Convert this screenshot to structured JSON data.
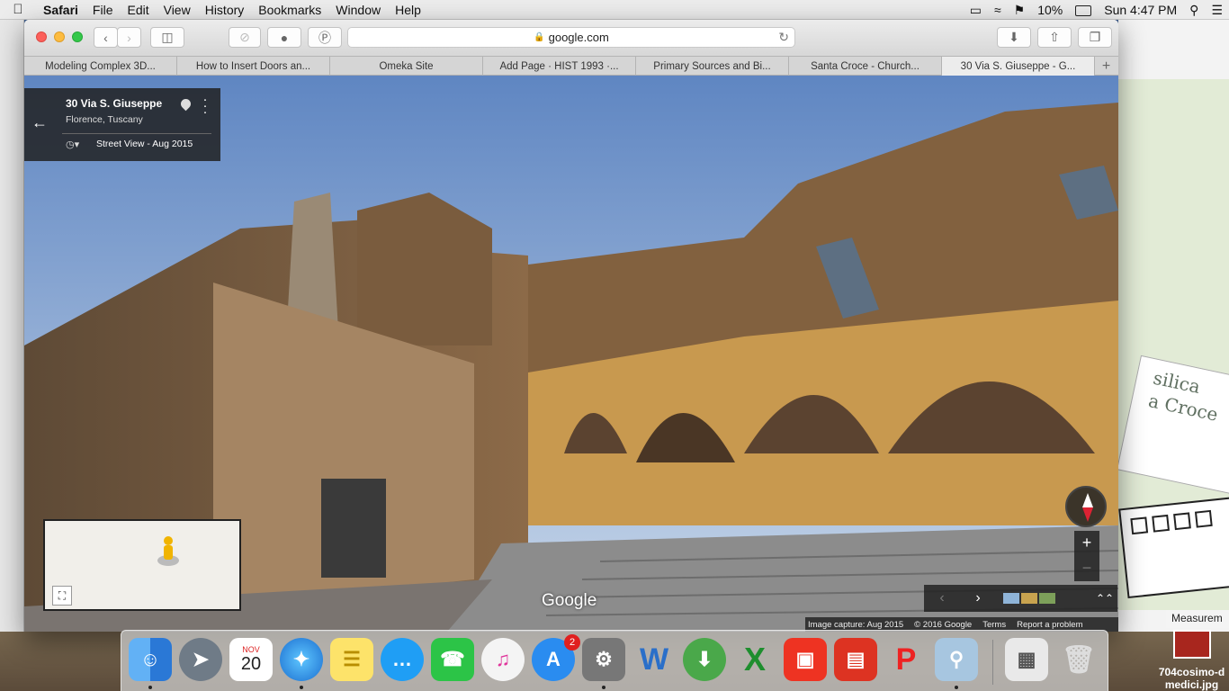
{
  "menubar": {
    "app": "Safari",
    "items": [
      "File",
      "Edit",
      "View",
      "History",
      "Bookmarks",
      "Window",
      "Help"
    ],
    "battery": "10%",
    "clock": "Sun 4:47 PM"
  },
  "browser": {
    "url": "google.com",
    "tabs": [
      "Modeling Complex 3D...",
      "How to Insert Doors an...",
      "Omeka Site",
      "Add Page · HIST 1993 ·...",
      "Primary Sources and Bi...",
      "Santa Croce - Church...",
      "30 Via S. Giuseppe - G..."
    ],
    "active_tab_index": 6,
    "new_tab": "+"
  },
  "streetview": {
    "address": "30 Via S. Giuseppe",
    "city": "Florence, Tuscany",
    "history_label": "Street View - Aug 2015",
    "logo": "Google",
    "zoom_in": "+",
    "zoom_out": "−",
    "footer": {
      "capture": "Image capture: Aug 2015",
      "copyright": "© 2016 Google",
      "terms": "Terms",
      "report": "Report a problem"
    }
  },
  "desktop": {
    "card_text_1": "silica",
    "card_text_2": "a Croce",
    "window_label": "Measurem",
    "file_name_1": "704cosimo-d",
    "file_name_2": "medici.jpg"
  },
  "dock": {
    "calendar_month": "NOV",
    "calendar_day": "20",
    "appstore_badge": "2",
    "apps": [
      "finder",
      "launchpad",
      "calendar",
      "safari",
      "notes",
      "messages",
      "facetime",
      "itunes",
      "app-store",
      "system-preferences",
      "word",
      "downloader",
      "excel",
      "sketchup",
      "layout",
      "style-builder",
      "preview",
      "finder-window",
      "trash"
    ]
  },
  "colors": {
    "sky": "#7ea3d6",
    "stone": "#8c6a48",
    "facade": "#c8994f",
    "accent_red": "#d23"
  }
}
